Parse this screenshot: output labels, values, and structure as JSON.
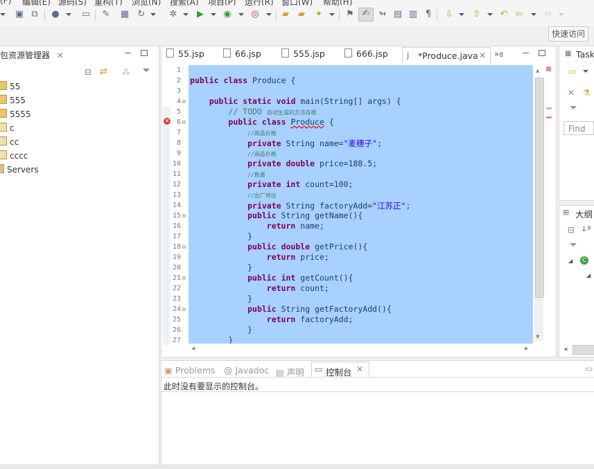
{
  "menubar": {
    "items": [
      "(F)",
      "编辑(E)",
      "源码(S)",
      "重构(T)",
      "浏览(N)",
      "搜索(A)",
      "项目(P)",
      "运行(R)",
      "窗口(W)",
      "帮助(H)"
    ]
  },
  "toolbar": {
    "quick_access": "快速访问"
  },
  "package_explorer": {
    "title": "包资源管理器",
    "items": [
      "55",
      "555",
      "5555",
      "c",
      "cc",
      "cccc",
      "Servers"
    ]
  },
  "editor": {
    "tabs": [
      "55.jsp",
      "66.jsp",
      "555.jsp",
      "666.jsp"
    ],
    "active_tab": "*Produce.java",
    "overflow_count": "8",
    "line_numbers": [
      "1",
      "2",
      "3",
      "4",
      "5",
      "6",
      "7",
      "8",
      "9",
      "10",
      "11",
      "12",
      "13",
      "14",
      "15",
      "16",
      "17",
      "18",
      "19",
      "20",
      "21",
      "22",
      "23",
      "24",
      "25",
      "26",
      "27"
    ],
    "lines": {
      "l2": "Produce {",
      "l4_sig": "main(String[] args) {",
      "l5_todo": "// TODO",
      "l5_note": "自动生成的方法存根",
      "l6_name": "Produce",
      "l7": "//商品价格",
      "l8_decl": "String name=",
      "l8_val": "\"麦穗子\"",
      "l9": "//商品价格",
      "l10_decl": "price=188.5;",
      "l11": "//数量",
      "l12_decl": "count=100;",
      "l13": "//出厂地址",
      "l14_decl": "String factoryAdd=",
      "l14_val": "\"江苏正\"",
      "l15": "String getName(){",
      "l16": "name;",
      "l18": "getPrice(){",
      "l19": "price;",
      "l21": "getCount(){",
      "l22": "count;",
      "l24": "String getFactoryAdd(){",
      "l25": "factoryAdd;"
    },
    "keywords": {
      "public": "public",
      "class": "class",
      "static": "static",
      "void": "void",
      "private": "private",
      "double": "double",
      "int": "int",
      "return": "return"
    }
  },
  "console": {
    "tabs": [
      "Problems",
      "Javadoc",
      "声明"
    ],
    "active_tab": "控制台",
    "message": "此时没有要显示的控制台。"
  },
  "right_panels": {
    "task_title": "Task",
    "find_placeholder": "Find",
    "outline_title": "大纲"
  },
  "colors": {
    "selection": "#a8d1ff",
    "keyword": "#7f0055",
    "string": "#2a00ff",
    "comment": "#3f7f5f"
  }
}
